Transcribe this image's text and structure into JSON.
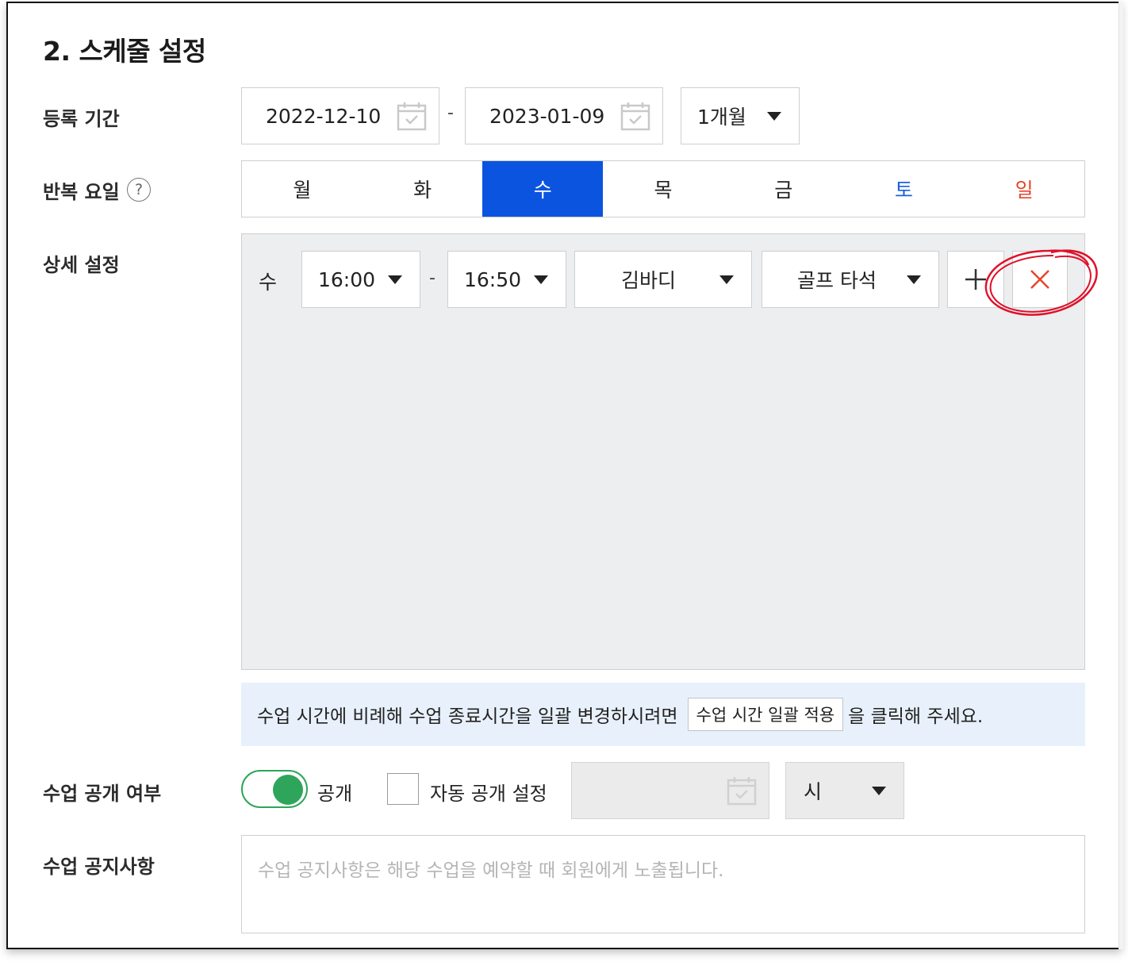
{
  "section": {
    "title": "2. 스케줄 설정"
  },
  "registration": {
    "label": "등록 기간",
    "start_date": "2022-12-10",
    "separator": "-",
    "end_date": "2023-01-09",
    "period_select": "1개월"
  },
  "repeat_days": {
    "label": "반복 요일",
    "help": "?",
    "days": [
      "월",
      "화",
      "수",
      "목",
      "금",
      "토",
      "일"
    ],
    "selected": "수",
    "colors": {
      "active_bg": "#0b54e0",
      "saturday": "#1e5fe0",
      "sunday": "#e5462b"
    }
  },
  "detail": {
    "label": "상세 설정",
    "row": {
      "day": "수",
      "start_time": "16:00",
      "separator": "-",
      "end_time": "16:50",
      "instructor": "김바디",
      "location": "골프 타석",
      "add_icon": "plus-icon",
      "delete_icon": "close-icon"
    },
    "annotation": {
      "type": "hand-drawn circle",
      "color": "#e0102a"
    }
  },
  "info": {
    "text_before": "수업 시간에 비례해 수업 종료시간을 일괄 변경하시려면",
    "button": "수업 시간 일괄 적용",
    "text_after": "을 클릭해 주세요."
  },
  "visibility": {
    "label": "수업 공개 여부",
    "toggle_on": true,
    "toggle_label": "공개",
    "auto_label": "자동 공개 설정",
    "auto_checked": false,
    "hour_select": "시",
    "toggle_color": "#2ea55b"
  },
  "notice": {
    "label": "수업 공지사항",
    "placeholder": "수업 공지사항은 해당 수업을 예약할 때 회원에게 노출됩니다."
  }
}
